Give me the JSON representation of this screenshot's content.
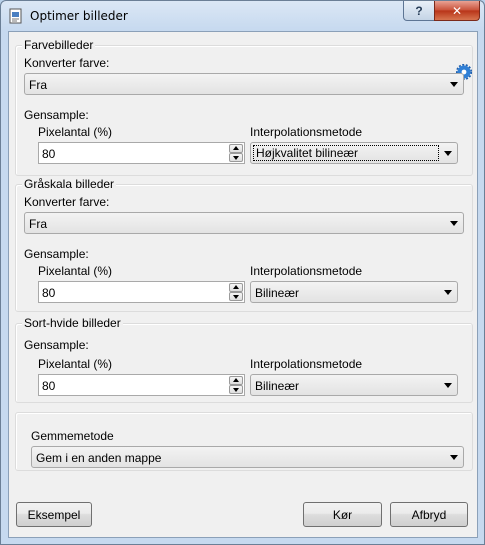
{
  "window": {
    "title": "Optimer billeder",
    "help_label": "?",
    "close_label": "✕"
  },
  "icons": {
    "app": "document-icon",
    "settings": "gear-icon"
  },
  "color_group": {
    "title": "Farvebilleder",
    "convert_label": "Konverter farve:",
    "convert_value": "Fra",
    "resample_label": "Gensample:",
    "pixels_label": "Pixelantal (%)",
    "pixels_value": "80",
    "interp_label": "Interpolationsmetode",
    "interp_value": "Højkvalitet bilineær"
  },
  "gray_group": {
    "title": "Gråskala billeder",
    "convert_label": "Konverter farve:",
    "convert_value": "Fra",
    "resample_label": "Gensample:",
    "pixels_label": "Pixelantal (%)",
    "pixels_value": "80",
    "interp_label": "Interpolationsmetode",
    "interp_value": "Bilineær"
  },
  "bw_group": {
    "title": "Sort-hvide billeder",
    "resample_label": "Gensample:",
    "pixels_label": "Pixelantal (%)",
    "pixels_value": "80",
    "interp_label": "Interpolationsmetode",
    "interp_value": "Bilineær"
  },
  "save_group": {
    "method_label": "Gemmemetode",
    "method_value": "Gem i en anden mappe"
  },
  "buttons": {
    "example": "Eksempel",
    "run": "Kør",
    "cancel": "Afbryd"
  }
}
